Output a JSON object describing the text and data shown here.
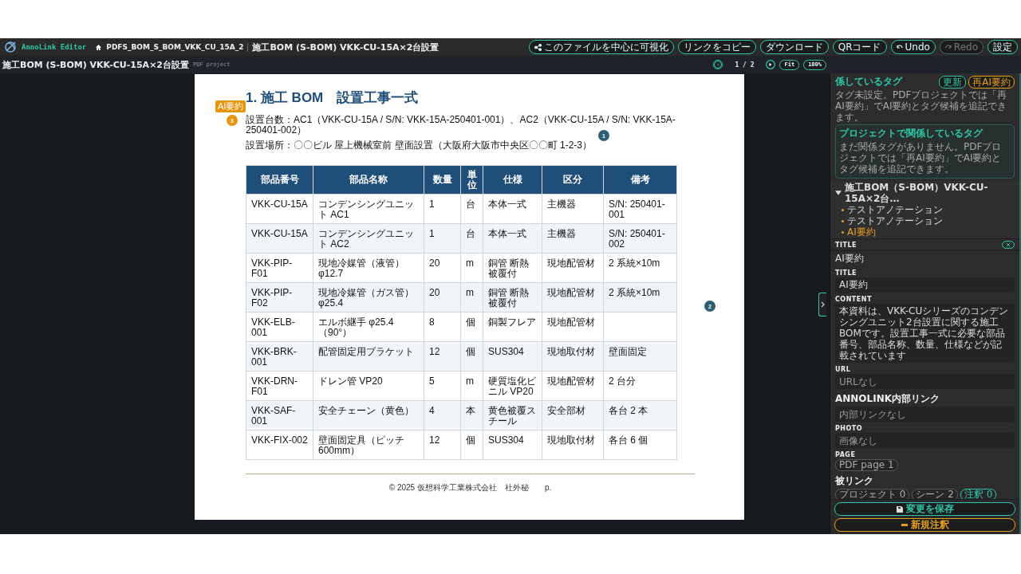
{
  "app": {
    "name": "AnnoLink Editor",
    "breadcrumb": [
      "PDFS_BOM_S_BOM_VKK_CU_15A_2",
      "施工BOM (S-BOM) VKK-CU-15A×2台設置"
    ],
    "actions": [
      {
        "label": "このファイルを中心に可視化",
        "disabled": false
      },
      {
        "label": "リンクをコピー",
        "disabled": false
      },
      {
        "label": "ダウンロード",
        "disabled": false
      },
      {
        "label": "QRコード",
        "disabled": false
      },
      {
        "label": "Undo",
        "disabled": false
      },
      {
        "label": "Redo",
        "disabled": true
      },
      {
        "label": "設定",
        "disabled": false
      }
    ]
  },
  "subbar": {
    "title": "施工BOM (S-BOM) VKK-CU-15A×2台設置",
    "subtitle": "PDF project",
    "page": "1 / 2",
    "zoom": [
      "Fit",
      "100%"
    ]
  },
  "document": {
    "heading": "1. 施工 BOM　設置工事一式",
    "lines": [
      "設置台数：AC1（VKK-CU-15A / S/N: VKK-15A-250401-001）、AC2（VKK-CU-15A / S/N: VKK-15A-250401-002）",
      "設置場所：〇〇ビル 屋上機械室前 壁面設置（大阪府大阪市中央区〇〇町 1-2-3）"
    ],
    "ai_tag": {
      "label": "AI要約",
      "number": "3"
    },
    "markers": [
      "1",
      "2"
    ],
    "table": {
      "columns": [
        "部品番号",
        "部品名称",
        "数量",
        "単位",
        "仕様",
        "区分",
        "備考"
      ],
      "rows": [
        [
          "VKK-CU-15A",
          "コンデンシングユニット AC1",
          "1",
          "台",
          "本体一式",
          "主機器",
          "S/N: 250401-001"
        ],
        [
          "VKK-CU-15A",
          "コンデンシングユニット AC2",
          "1",
          "台",
          "本体一式",
          "主機器",
          "S/N: 250401-002"
        ],
        [
          "VKK-PIP-F01",
          "現地冷媒管（液管）φ12.7",
          "20",
          "m",
          "銅管 断熱被覆付",
          "現地配管材",
          "2 系統×10m"
        ],
        [
          "VKK-PIP-F02",
          "現地冷媒管（ガス管）φ25.4",
          "20",
          "m",
          "銅管 断熱被覆付",
          "現地配管材",
          "2 系統×10m"
        ],
        [
          "VKK-ELB-001",
          "エルボ継手 φ25.4（90°）",
          "8",
          "個",
          "銅製フレア",
          "現地配管材",
          ""
        ],
        [
          "VKK-BRK-001",
          "配管固定用ブラケット",
          "12",
          "個",
          "SUS304",
          "現地取付材",
          "壁面固定"
        ],
        [
          "VKK-DRN-F01",
          "ドレン管 VP20",
          "5",
          "m",
          "硬質塩化ビニル VP20",
          "現地配管材",
          "2 台分"
        ],
        [
          "VKK-SAF-001",
          "安全チェーン（黄色）",
          "4",
          "本",
          "黄色被覆スチール",
          "安全部材",
          "各台 2 本"
        ],
        [
          "VKK-FIX-002",
          "壁面固定具（ピッチ 600mm）",
          "12",
          "個",
          "SUS304",
          "現地取付材",
          "各台 6 個"
        ]
      ]
    },
    "footer": "© 2025 仮想科学工業株式会社　社外秘　　p."
  },
  "sidebar": {
    "related_tags": {
      "title": "係しているタグ",
      "buttons": [
        {
          "label": "更新",
          "kind": "teal"
        },
        {
          "label": "再AI要約",
          "kind": "orange"
        }
      ],
      "note": "タグ未設定。PDFプロジェクトでは「再AI要約」でAI要約とタグ候補を追記できます。"
    },
    "project_tags": {
      "title": "プロジェクトで関係しているタグ",
      "note": "まだ関係タグがありません。PDFプロジェクトでは「再AI要約」でAI要約とタグ候補を追記できます。"
    },
    "tree": {
      "label": "施工BOM（S-BOM）VKK-CU-15A×2台…",
      "expanded": true,
      "children": [
        {
          "label": "テストアノテーション",
          "selected": false
        },
        {
          "label": "テストアノテーション",
          "selected": false
        },
        {
          "label": "AI要約",
          "selected": true
        }
      ]
    },
    "editor": {
      "header": "TITLE",
      "name": "AI要約",
      "fields": [
        {
          "label": "TITLE",
          "value": "AI要約"
        },
        {
          "label": "CONTENT",
          "value": "本資料は、VKK-CUシリーズのコンデンシングユニット2台設置に関する施工BOMです。設置工事一式に必要な部品番号、部品名称、数量、仕様などが記載されています"
        },
        {
          "label": "URL",
          "placeholder": "URLなし"
        },
        {
          "label": "ANNOLINK内部リンク",
          "placeholder": "内部リンクなし"
        },
        {
          "label": "PHOTO",
          "placeholder": "画像なし"
        }
      ],
      "page": {
        "label": "PAGE",
        "chip": "PDF page 1"
      },
      "backlinks": {
        "label": "被リンク",
        "chips": [
          {
            "label": "プロジェクト 0",
            "selected": false
          },
          {
            "label": "シーン 2",
            "selected": false
          },
          {
            "label": "注釈 0",
            "selected": true
          }
        ]
      }
    },
    "footer_buttons": [
      {
        "label": "変更を保存",
        "kind": "save"
      },
      {
        "label": "新規注釈",
        "kind": "new"
      }
    ]
  }
}
